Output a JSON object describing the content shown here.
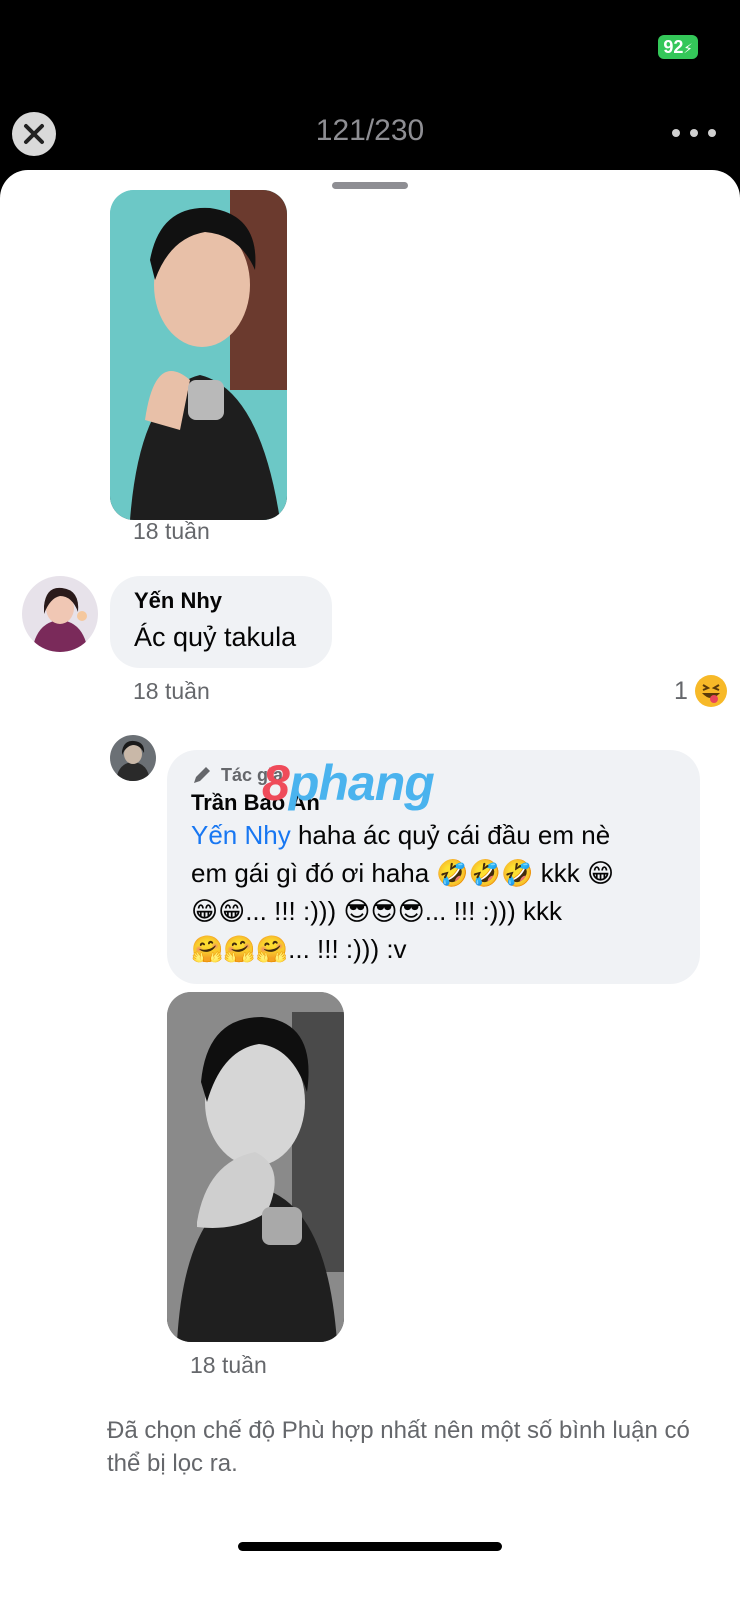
{
  "status_bar": {
    "battery_level": "92",
    "battery_color": "#34c759"
  },
  "viewer": {
    "counter": "121/230",
    "close_icon": "close-icon",
    "more_icon": "ellipsis-icon"
  },
  "comments": [
    {
      "type": "photo",
      "time": "18 tuần"
    },
    {
      "author": "Yến Nhy",
      "text": "Ác quỷ takula",
      "time": "18 tuần",
      "reaction_count": "1",
      "reaction_icon": "squinting-tongue-emoji"
    },
    {
      "badge": "Tác giả",
      "author": "Trần Bảo An",
      "mention": "Yến Nhy",
      "line1": " haha ác quỷ cái đầu em nè",
      "line2": "em gái gì đó ơi haha 🤣🤣🤣 kkk 😁",
      "line3": "😁😁... !!! :))) 😎😎😎... !!! :))) kkk",
      "line4": "🤗🤗🤗... !!! :))) :v",
      "time": "18 tuần"
    }
  ],
  "watermark": {
    "first": "8",
    "rest": "phang"
  },
  "footer_note": "Đã chọn chế độ Phù hợp nhất nên một số bình luận có thể bị lọc ra.",
  "accent_color": "#1877f2"
}
